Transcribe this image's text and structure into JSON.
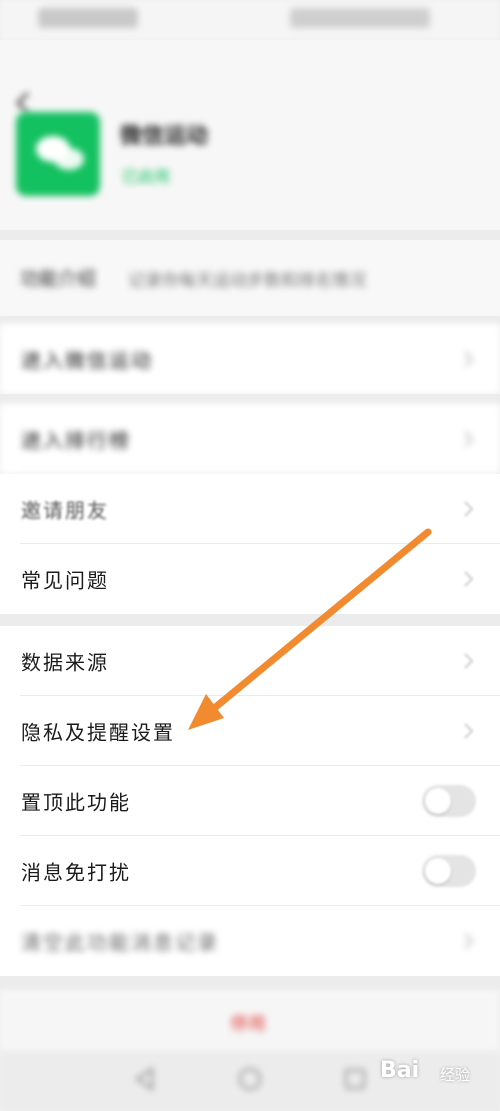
{
  "status_bar": {
    "left_text": "",
    "right_text": ""
  },
  "header": {
    "app_name": "微信运动",
    "app_status": "已启用",
    "intro_label": "功能介绍",
    "intro_text": "记录你每天运动步数和排名情况"
  },
  "rows": {
    "enter_sport": "进入微信运动",
    "enter_rank": "进入排行榜",
    "invite_friends": "邀请朋友",
    "faq": "常见问题",
    "data_source": "数据来源",
    "privacy_settings": "隐私及提醒设置",
    "pin_top": "置顶此功能",
    "mute": "消息免打扰",
    "clear_history": "清空此功能消息记录"
  },
  "toggles": {
    "pin_top": false,
    "mute": false
  },
  "bottom": {
    "clear_label": "停用"
  },
  "watermark": {
    "brand": "Bai",
    "sub": "经验"
  },
  "colors": {
    "accent_green": "#13c160",
    "arrow_orange": "#f28a30",
    "danger": "#e0443e"
  },
  "icons": {
    "back": "chevron-left-icon",
    "app": "wechat-sport-icon",
    "row_arrow": "chevron-right-icon",
    "nav_back": "triangle-back-icon",
    "nav_home": "circle-home-icon",
    "nav_recent": "square-recent-icon"
  }
}
